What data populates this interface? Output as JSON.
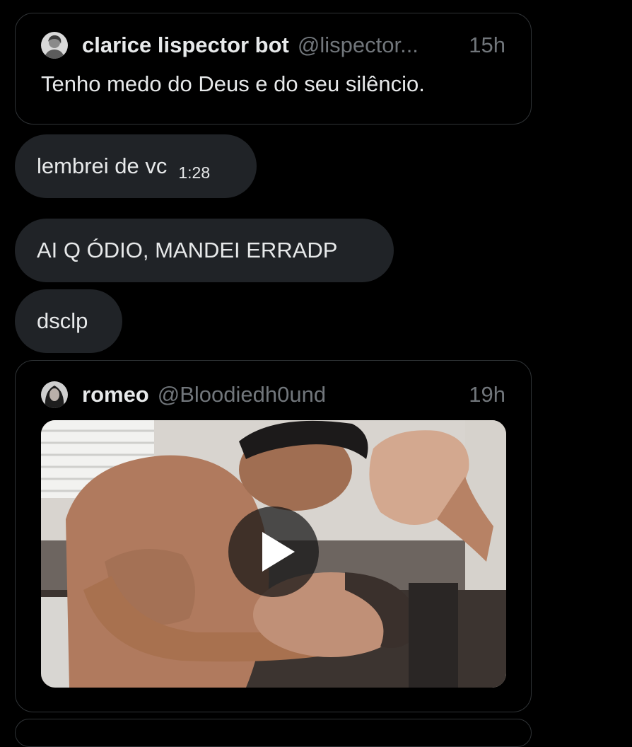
{
  "quoted_tweet_1": {
    "display_name": "clarice lispector bot",
    "handle": "@lispector...",
    "time": "15h",
    "text": "Tenho medo do Deus e do seu silêncio.",
    "avatar_icon": "portrait-avatar"
  },
  "messages": [
    {
      "text": "lembrei de vc",
      "time": "1:28"
    },
    {
      "text": "AI Q ÓDIO, MANDEI ERRADP"
    },
    {
      "text": "dsclp"
    }
  ],
  "quoted_tweet_2": {
    "display_name": "romeo",
    "handle": "@Bloodiedh0und",
    "time": "19h",
    "avatar_icon": "portrait-avatar",
    "media": {
      "type": "video",
      "play_icon": "play-icon"
    }
  },
  "colors": {
    "background": "#000000",
    "bubble": "#202327",
    "border": "#2f3336",
    "primary_text": "#e7e9ea",
    "secondary_text": "#71767b"
  }
}
